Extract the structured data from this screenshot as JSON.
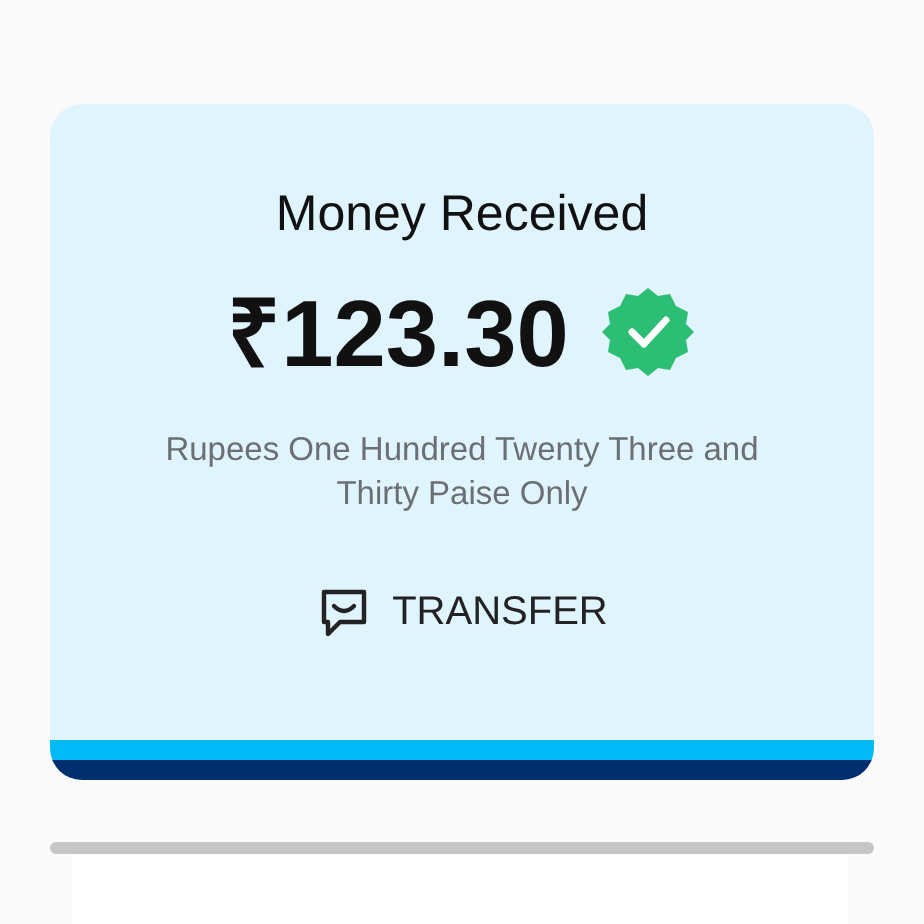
{
  "card": {
    "title": "Money Received",
    "amount": "₹123.30",
    "verified": true,
    "amount_words": "Rupees One Hundred Twenty Three and Thirty Paise Only",
    "action": "TRANSFER"
  }
}
